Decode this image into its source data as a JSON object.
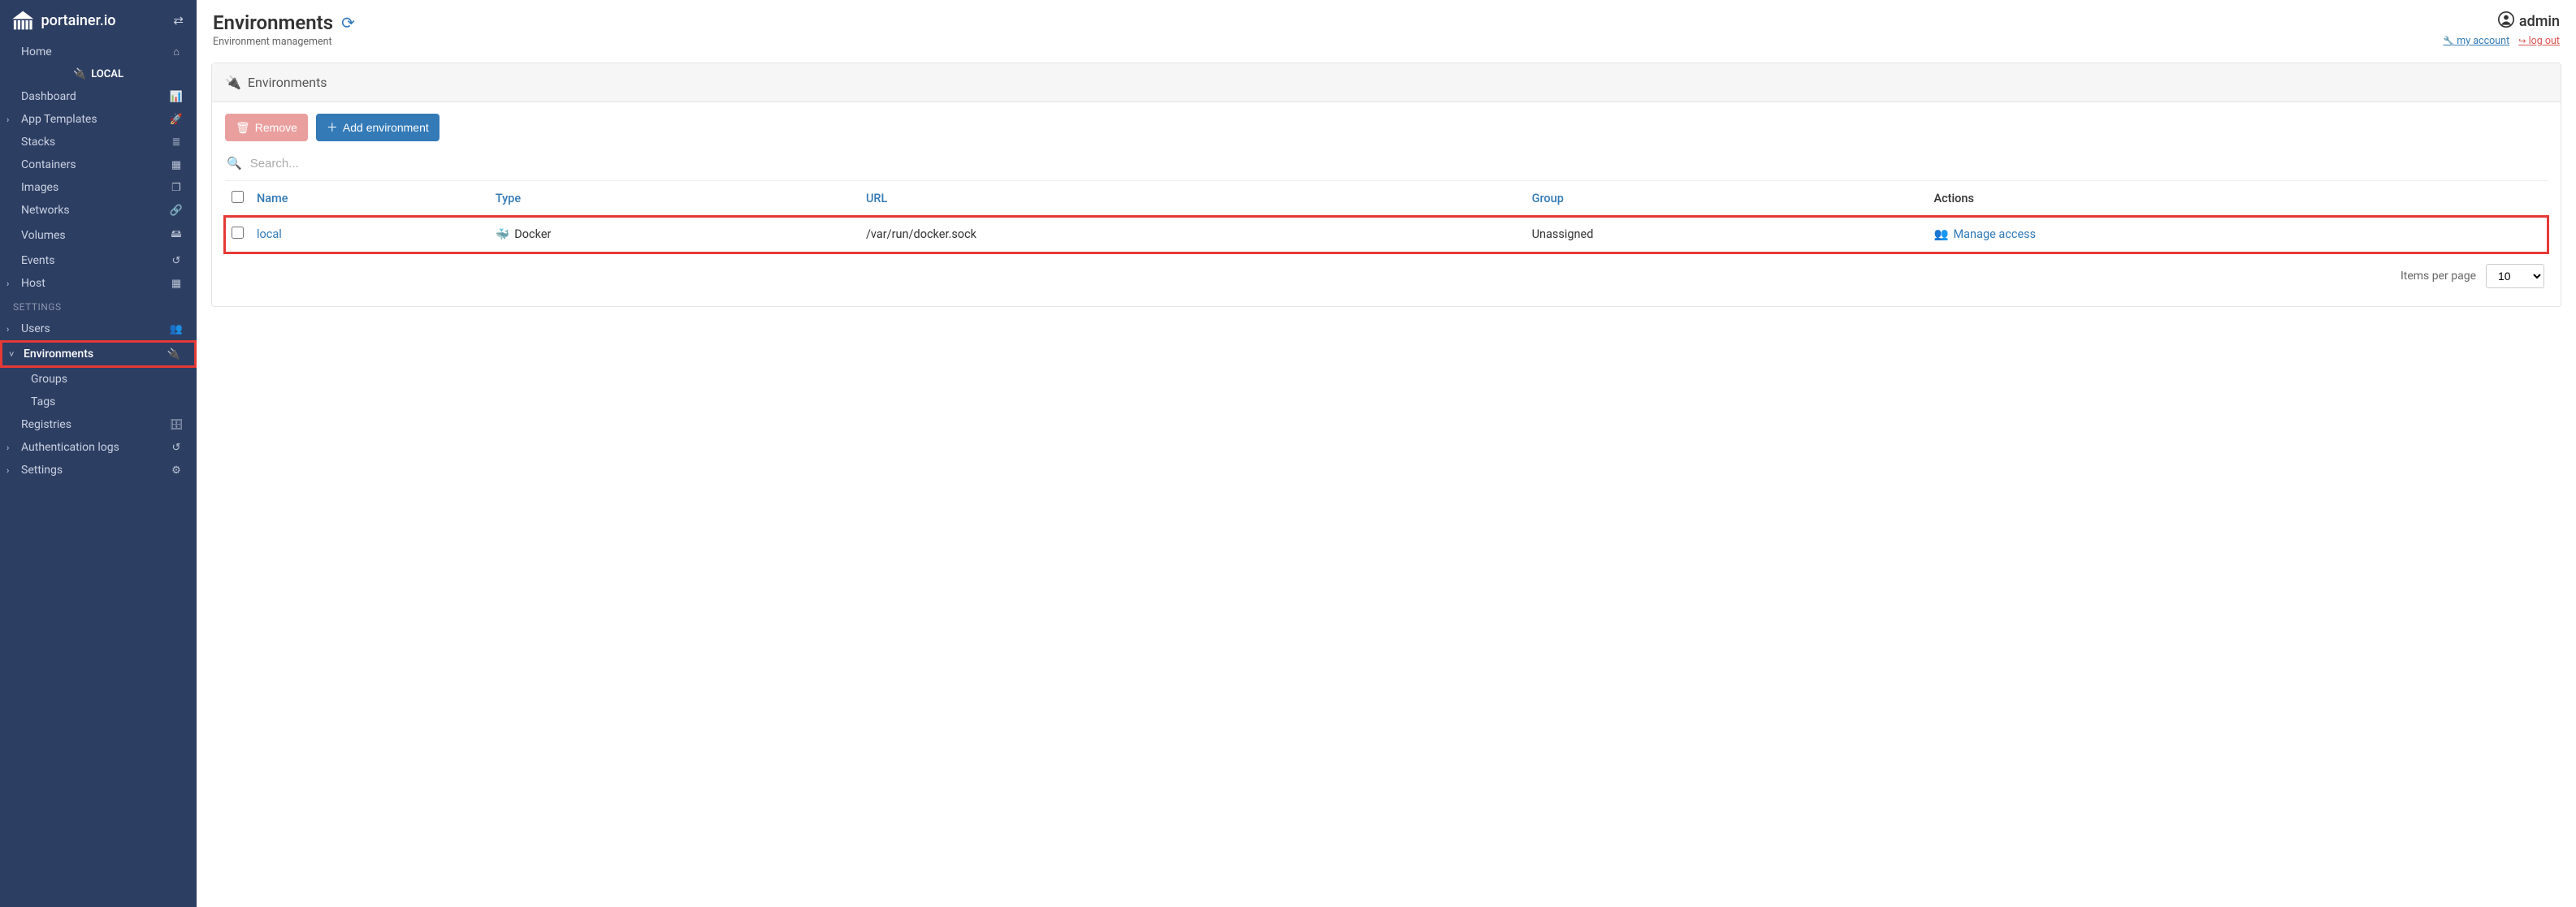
{
  "brand": "portainer.io",
  "sidebar": {
    "home": "Home",
    "local_header": "LOCAL",
    "items": {
      "dashboard": "Dashboard",
      "app_templates": "App Templates",
      "stacks": "Stacks",
      "containers": "Containers",
      "images": "Images",
      "networks": "Networks",
      "volumes": "Volumes",
      "events": "Events",
      "host": "Host"
    },
    "settings_label": "SETTINGS",
    "settings": {
      "users": "Users",
      "environments": "Environments",
      "groups": "Groups",
      "tags": "Tags",
      "registries": "Registries",
      "auth_logs": "Authentication logs",
      "settings": "Settings"
    }
  },
  "header": {
    "title": "Environments",
    "subtitle": "Environment management",
    "user": "admin",
    "my_account": "my account",
    "log_out": "log out"
  },
  "panel": {
    "title": "Environments",
    "remove": "Remove",
    "add": "Add environment",
    "search_placeholder": "Search...",
    "columns": {
      "name": "Name",
      "type": "Type",
      "url": "URL",
      "group": "Group",
      "actions": "Actions"
    },
    "rows": [
      {
        "name": "local",
        "type": "Docker",
        "url": "/var/run/docker.sock",
        "group": "Unassigned",
        "action": "Manage access"
      }
    ],
    "items_per_page_label": "Items per page",
    "items_per_page_value": "10"
  }
}
